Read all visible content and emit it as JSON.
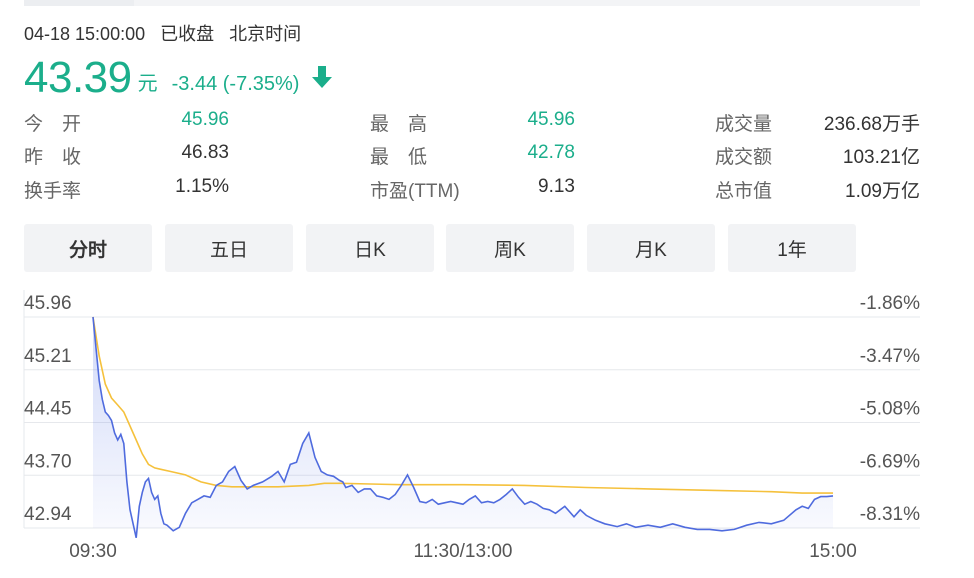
{
  "header": {
    "date_time": "04-18 15:00:00",
    "status": "已收盘",
    "timezone": "北京时间"
  },
  "quote": {
    "price": "43.39",
    "unit": "元",
    "change": "-3.44 (-7.35%)",
    "direction_icon": "arrow-down-icon",
    "color_down": "#1bae8b"
  },
  "stats": [
    {
      "label": "今　开",
      "value": "45.96",
      "color": "green"
    },
    {
      "label": "最　高",
      "value": "45.96",
      "color": "green"
    },
    {
      "label": "成交量",
      "value": "236.68万手",
      "color": "dark"
    },
    {
      "label": "昨　收",
      "value": "46.83",
      "color": "dark"
    },
    {
      "label": "最　低",
      "value": "42.78",
      "color": "green"
    },
    {
      "label": "成交额",
      "value": "103.21亿",
      "color": "dark"
    },
    {
      "label": "换手率",
      "value": "1.15%",
      "color": "dark"
    },
    {
      "label": "市盈(TTM)",
      "value": "9.13",
      "color": "dark"
    },
    {
      "label": "总市值",
      "value": "1.09万亿",
      "color": "dark"
    }
  ],
  "tabs": [
    {
      "label": "分时",
      "active": true
    },
    {
      "label": "五日",
      "active": false
    },
    {
      "label": "日K",
      "active": false
    },
    {
      "label": "周K",
      "active": false
    },
    {
      "label": "月K",
      "active": false
    },
    {
      "label": "1年",
      "active": false
    }
  ],
  "chart_data": {
    "type": "line",
    "title": "",
    "left_ticks": [
      "45.96",
      "45.21",
      "44.45",
      "43.70",
      "42.94"
    ],
    "right_ticks": [
      "-1.86%",
      "-3.47%",
      "-5.08%",
      "-6.69%",
      "-8.31%"
    ],
    "x_ticks": [
      "09:30",
      "11:30/13:00",
      "15:00"
    ],
    "ylim": [
      42.94,
      45.96
    ],
    "xlim": [
      0,
      240
    ],
    "grid": true,
    "colors": {
      "price": "#4f6bde",
      "avg": "#f5c13c"
    },
    "series": [
      {
        "role": "price",
        "x": [
          0,
          1,
          2,
          3,
          4,
          5,
          6,
          7,
          8,
          9,
          10,
          11,
          12,
          13,
          14,
          15,
          16,
          17,
          18,
          19,
          20,
          21,
          22,
          23,
          24,
          26,
          28,
          30,
          32,
          34,
          36,
          38,
          40,
          42,
          44,
          46,
          48,
          50,
          52,
          55,
          58,
          60,
          62,
          64,
          66,
          68,
          70,
          72,
          74,
          76,
          78,
          80,
          81,
          82,
          84,
          86,
          88,
          90,
          92,
          94,
          96,
          98,
          100,
          102,
          104,
          106,
          108,
          110,
          112,
          114,
          116,
          118,
          120,
          122,
          124,
          126,
          128,
          130,
          132,
          134,
          136,
          138,
          140,
          142,
          144,
          146,
          148,
          150,
          153,
          156,
          158,
          160,
          163,
          166,
          170,
          173,
          176,
          180,
          184,
          188,
          192,
          196,
          200,
          204,
          208,
          212,
          216,
          220,
          224,
          228,
          230,
          232,
          234,
          236,
          238,
          240
        ],
        "values": [
          45.96,
          45.5,
          45.05,
          44.78,
          44.6,
          44.55,
          44.48,
          44.3,
          44.2,
          44.28,
          44.15,
          43.6,
          43.2,
          43.0,
          42.8,
          43.25,
          43.45,
          43.6,
          43.65,
          43.45,
          43.35,
          43.4,
          43.15,
          43.0,
          42.98,
          42.9,
          42.95,
          43.15,
          43.3,
          43.35,
          43.4,
          43.38,
          43.55,
          43.6,
          43.75,
          43.82,
          43.62,
          43.5,
          43.55,
          43.6,
          43.68,
          43.75,
          43.6,
          43.85,
          43.88,
          44.15,
          44.3,
          43.95,
          43.75,
          43.7,
          43.68,
          43.62,
          43.6,
          43.52,
          43.55,
          43.45,
          43.5,
          43.5,
          43.4,
          43.38,
          43.35,
          43.42,
          43.55,
          43.7,
          43.52,
          43.32,
          43.3,
          43.35,
          43.28,
          43.3,
          43.32,
          43.3,
          43.28,
          43.35,
          43.4,
          43.3,
          43.32,
          43.3,
          43.35,
          43.42,
          43.5,
          43.38,
          43.28,
          43.32,
          43.28,
          43.22,
          43.2,
          43.15,
          43.25,
          43.1,
          43.2,
          43.12,
          43.05,
          43.0,
          42.96,
          43.0,
          42.95,
          42.98,
          42.95,
          43.0,
          42.95,
          42.92,
          42.92,
          42.9,
          42.92,
          42.98,
          43.02,
          43.0,
          43.05,
          43.2,
          43.25,
          43.22,
          43.35,
          43.39,
          43.39,
          43.4
        ]
      },
      {
        "role": "avg",
        "x": [
          0,
          2,
          4,
          6,
          8,
          10,
          12,
          14,
          16,
          18,
          20,
          22,
          25,
          30,
          35,
          40,
          45,
          50,
          60,
          70,
          75,
          80,
          90,
          100,
          120,
          140,
          160,
          180,
          200,
          220,
          230,
          240
        ],
        "values": [
          45.96,
          45.4,
          45.0,
          44.8,
          44.7,
          44.6,
          44.4,
          44.2,
          44.0,
          43.85,
          43.8,
          43.78,
          43.75,
          43.7,
          43.6,
          43.55,
          43.53,
          43.53,
          43.53,
          43.55,
          43.58,
          43.58,
          43.57,
          43.56,
          43.56,
          43.55,
          43.52,
          43.5,
          43.48,
          43.46,
          43.44,
          43.44
        ]
      }
    ]
  }
}
